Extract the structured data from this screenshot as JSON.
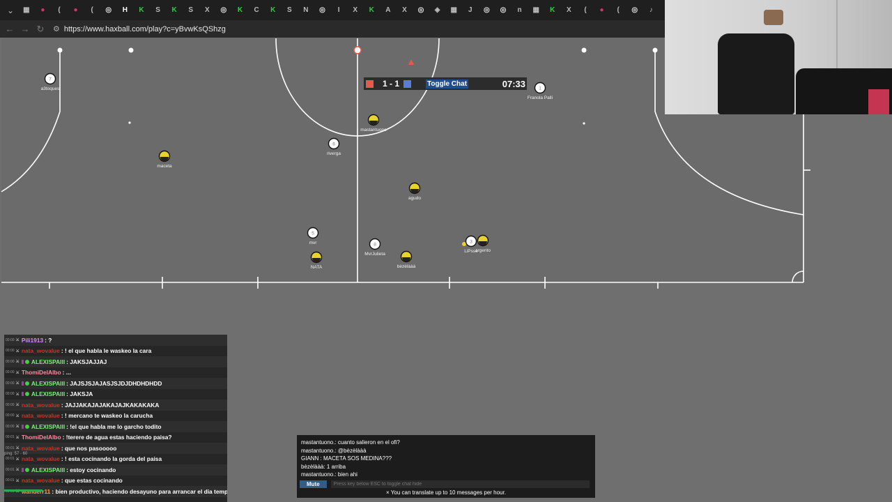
{
  "browser": {
    "url": "https://www.haxball.com/play?c=yBvwKsQShzg",
    "tab_count": 40,
    "tab_glyphs": [
      "▦",
      "●",
      "(",
      "●",
      "(",
      "◎",
      "H",
      "K",
      "S",
      "K",
      "S",
      "X",
      "◎",
      "K",
      "C",
      "K",
      "S",
      "N",
      "◎",
      "I",
      "X",
      "K",
      "A",
      "X",
      "◎",
      "◈",
      "▦",
      "J",
      "◎",
      "◎",
      "n",
      "▦",
      "K",
      "X",
      "(",
      "●",
      "(",
      "◎",
      "♪",
      "R"
    ]
  },
  "scoreboard": {
    "red_score": "1",
    "separator": "-",
    "blue_score": "1",
    "score_text": "1 - 1",
    "toggle_chat_label": "Toggle Chat",
    "time": "07:33",
    "red_color": "#e55a4f",
    "blue_color": "#5b7bd8"
  },
  "players": [
    {
      "name": "a3toques",
      "number": "7",
      "team": "white"
    },
    {
      "name": "maceta",
      "number": "",
      "team": "yellow"
    },
    {
      "name": "mastantuono",
      "number": "",
      "team": "yellow"
    },
    {
      "name": "riverga",
      "number": "6",
      "team": "white"
    },
    {
      "name": "Franola Palli",
      "number": "1",
      "team": "white"
    },
    {
      "name": "agudo",
      "number": "",
      "team": "yellow"
    },
    {
      "name": "mvr",
      "number": "5",
      "team": "white"
    },
    {
      "name": "NATA",
      "number": "",
      "team": "yellow"
    },
    {
      "name": "MvrJulieta",
      "number": "8",
      "team": "white"
    },
    {
      "name": "bèzèlààà",
      "number": "",
      "team": "yellow"
    },
    {
      "name": "LiPsse",
      "number": "3",
      "team": "white"
    },
    {
      "name": "argento",
      "number": "",
      "team": "yellow"
    }
  ],
  "stream_chat": {
    "lines": [
      {
        "ts": "00:00",
        "user": "Pili1913",
        "user_color": "#d28cff",
        "badge": false,
        "vip": false,
        "text": ": ?"
      },
      {
        "ts": "00:00",
        "user": "nata_wovalue",
        "user_color": "#c0392b",
        "badge": false,
        "vip": false,
        "text": ": ! el que habla le waskeo la cara"
      },
      {
        "ts": "00:00",
        "user": "ALEXISPAIII",
        "user_color": "#7bf07b",
        "badge": true,
        "vip": true,
        "text": ": JAKSJAJJAJ"
      },
      {
        "ts": "00:00",
        "user": "ThomiDelAlbo",
        "user_color": "#ff8aa0",
        "badge": false,
        "vip": false,
        "text": ": ..."
      },
      {
        "ts": "00:00",
        "user": "ALEXISPAIII",
        "user_color": "#7bf07b",
        "badge": true,
        "vip": true,
        "text": ": JAJSJSJAJASJSJDJDHDHDHDD"
      },
      {
        "ts": "00:00",
        "user": "ALEXISPAIII",
        "user_color": "#7bf07b",
        "badge": true,
        "vip": true,
        "text": ": JAKSJA"
      },
      {
        "ts": "00:00",
        "user": "nata_wovalue",
        "user_color": "#c0392b",
        "badge": false,
        "vip": false,
        "text": ": JAJJAKAJAJAKAJAJKAKAKAKA"
      },
      {
        "ts": "00:00",
        "user": "nata_wovalue",
        "user_color": "#c0392b",
        "badge": false,
        "vip": false,
        "text": ": ! mercano te waskeo la carucha"
      },
      {
        "ts": "00:00",
        "user": "ALEXISPAIII",
        "user_color": "#7bf07b",
        "badge": true,
        "vip": true,
        "text": ": !el que habla me lo garcho todito"
      },
      {
        "ts": "00:01",
        "user": "ThomiDelAlbo",
        "user_color": "#ff8aa0",
        "badge": false,
        "vip": false,
        "text": ": !terere de agua estas haciendo paisa?"
      },
      {
        "ts": "00:01",
        "user": "nata_wovalue",
        "user_color": "#c0392b",
        "badge": false,
        "vip": false,
        "text": ": que nos pasooooo"
      },
      {
        "ts": "00:01",
        "user": "nata_wovalue",
        "user_color": "#c0392b",
        "badge": false,
        "vip": false,
        "text": ": ! esta cocinando la gorda del paisa"
      },
      {
        "ts": "00:01",
        "user": "ALEXISPAIII",
        "user_color": "#7bf07b",
        "badge": true,
        "vip": true,
        "text": ": estoy cocinando"
      },
      {
        "ts": "00:01",
        "user": "nata_wovalue",
        "user_color": "#c0392b",
        "badge": false,
        "vip": false,
        "text": ": que estas cocinando"
      },
      {
        "ts": "00:01",
        "user": "wanderr11",
        "user_color": "#ff9f43",
        "badge": false,
        "vip": false,
        "text": ": bien productivo, haciendo desayuno para arrancar el dia temprano"
      }
    ],
    "side_note": "ping: 57 · 60"
  },
  "ingame_chat": {
    "messages": [
      "mastantuono.: cuanto salieron en el ofi?",
      "mastantuono.: @bèzèlààà",
      "GIANN : MACETA SOS MEDINA???",
      "bèzèlààà: 1 arriba",
      "mastantuono.: bien ahi"
    ],
    "mute_label": "Mute",
    "input_placeholder": "Press key below ESC to toggle chat hide",
    "notice": "× You can translate up to 10 messages per hour."
  }
}
